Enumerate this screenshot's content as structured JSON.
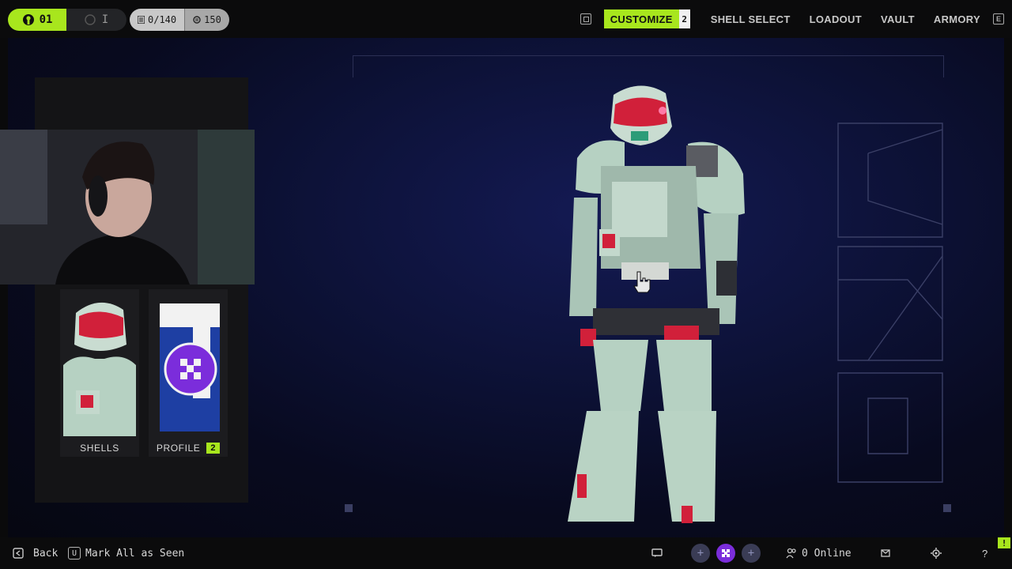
{
  "topbar": {
    "level": "01",
    "level_alt": "I",
    "counter_items": "0/140",
    "counter_currency": "150",
    "nav": [
      {
        "label": "CUSTOMIZE",
        "badge": "2",
        "active": true
      },
      {
        "label": "SHELL SELECT"
      },
      {
        "label": "LOADOUT"
      },
      {
        "label": "VAULT"
      },
      {
        "label": "ARMORY"
      }
    ]
  },
  "left_panel": {
    "cards": [
      {
        "label": "SHELLS"
      },
      {
        "label": "PROFILE",
        "badge": "2"
      }
    ]
  },
  "bottombar": {
    "back_label": "Back",
    "mark_key": "U",
    "mark_label": "Mark All as Seen",
    "online_label": "0 Online",
    "warn_label": "!"
  },
  "colors": {
    "accent": "#a8e61d",
    "stage_bg": "#0d1238",
    "armor_mint": "#b6d1c2",
    "armor_red": "#d1203a",
    "profile_purple": "#7b2ddb",
    "profile_blue": "#1e3fa3"
  },
  "icons": [
    "user-level-icon",
    "list-icon",
    "currency-icon",
    "panel-toggle-icon",
    "menu-e-icon",
    "back-icon",
    "key-u-icon",
    "chat-icon",
    "plus-icon",
    "profile-emblem-icon",
    "friends-icon",
    "mail-icon",
    "settings-gear-icon",
    "help-icon",
    "hand-cursor-icon"
  ]
}
